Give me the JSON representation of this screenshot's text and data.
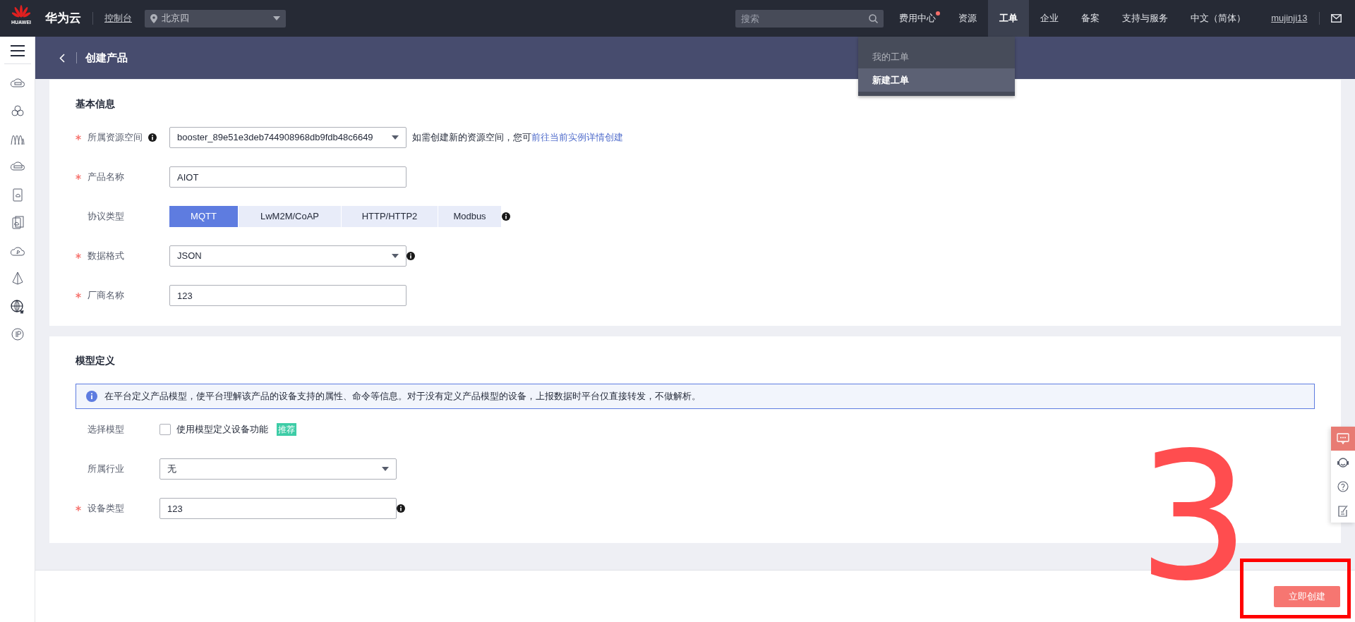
{
  "topbar": {
    "brand": "HUAWEI",
    "title": "华为云",
    "console": "控制台",
    "region": "北京四",
    "search": {
      "placeholder": "搜索"
    },
    "nav": [
      {
        "label": "费用中心",
        "selected": false,
        "notification": true
      },
      {
        "label": "资源",
        "selected": false,
        "notification": false
      },
      {
        "label": "工单",
        "selected": true,
        "notification": false
      },
      {
        "label": "企业",
        "selected": false,
        "notification": false
      },
      {
        "label": "备案",
        "selected": false,
        "notification": false
      },
      {
        "label": "支持与服务",
        "selected": false,
        "notification": false
      },
      {
        "label": "中文（简体）",
        "selected": false,
        "notification": false
      }
    ],
    "user": "mujinji13"
  },
  "dropdown": {
    "items": [
      {
        "label": "我的工单",
        "selected": false
      },
      {
        "label": "新建工单",
        "selected": true
      }
    ]
  },
  "page_title": "创建产品",
  "sections": [
    {
      "title": "基本信息",
      "fields": [
        {
          "kind": "select",
          "label": "所属资源空间",
          "required": true,
          "info": true,
          "value": "booster_89e51e3deb744908968db9fdb48c6649",
          "hint": "如需创建新的资源空间，您可",
          "link": "前往当前实例详情创建"
        },
        {
          "kind": "input",
          "label": "产品名称",
          "required": true,
          "info": false,
          "value": "AIOT"
        },
        {
          "kind": "segmented",
          "label": "协议类型",
          "required": false,
          "info": true,
          "options": [
            {
              "label": "MQTT",
              "selected": true
            },
            {
              "label": "LwM2M/CoAP",
              "selected": false
            },
            {
              "label": "HTTP/HTTP2",
              "selected": false
            },
            {
              "label": "Modbus",
              "selected": false
            }
          ]
        },
        {
          "kind": "select",
          "label": "数据格式",
          "required": true,
          "info": true,
          "value": "JSON"
        },
        {
          "kind": "input",
          "label": "厂商名称",
          "required": true,
          "info": false,
          "value": "123"
        }
      ]
    },
    {
      "title": "模型定义",
      "alert": "在平台定义产品模型，使平台理解该产品的设备支持的属性、命令等信息。对于没有定义产品模型的设备，上报数据时平台仅直接转发，不做解析。",
      "fields": [
        {
          "kind": "checkbox",
          "label": "选择模型",
          "required": false,
          "info": false,
          "checked": false,
          "text": "使用模型定义设备功能",
          "tag": "推荐"
        },
        {
          "kind": "select",
          "label": "所属行业",
          "required": false,
          "info": false,
          "value": "无"
        },
        {
          "kind": "input",
          "label": "设备类型",
          "required": true,
          "info": true,
          "value": "123"
        }
      ]
    }
  ],
  "float_toolbar": [
    {
      "selected": true
    },
    {
      "selected": false
    },
    {
      "selected": false
    },
    {
      "selected": false
    }
  ],
  "submit": "立即创建",
  "annotation": {
    "text": "3"
  }
}
